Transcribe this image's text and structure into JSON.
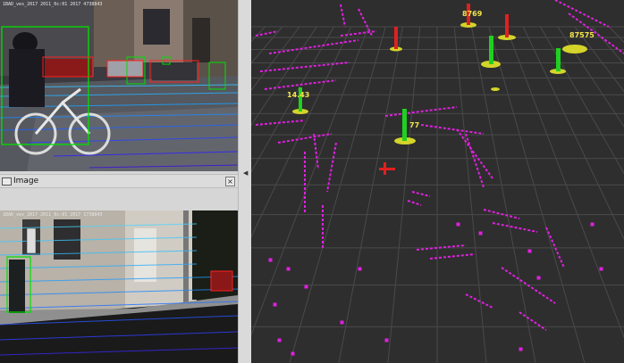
{
  "camera_top": {
    "caption": "1BAD_ves_2017 2011_0c:01 2017 4738843"
  },
  "image_panel": {
    "title": "Image",
    "close_symbol": "×",
    "caption": "1BAD_ves_2017 2011_0c:01 2017 1738843"
  },
  "splitter": {
    "arrow": "◀"
  },
  "view3d": {
    "labels": {
      "left_obstacle": "14.43",
      "center_obstacle": "77",
      "top_obstacle": "8769",
      "right_obstacle": "87575"
    }
  },
  "colors": {
    "grid": "#4a4a4a",
    "points": "#e020e0",
    "boxes": "#00d000",
    "markers": "#cccc20",
    "arrows": "#e02020"
  }
}
